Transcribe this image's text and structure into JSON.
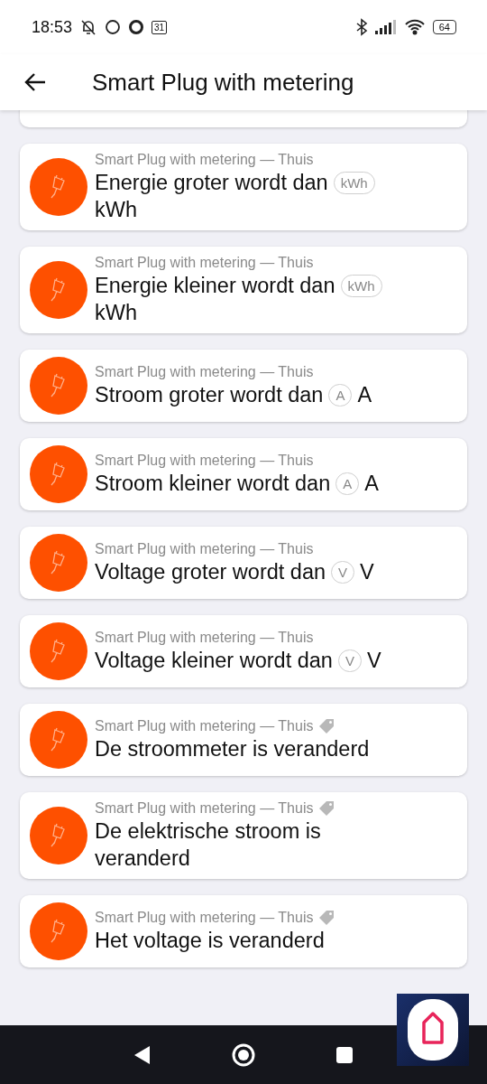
{
  "status_bar": {
    "time": "18:53",
    "calendar_day": "31",
    "battery": "64"
  },
  "app_bar": {
    "title": "Smart Plug with metering"
  },
  "cards": [
    {
      "subtitle": "Smart Plug with metering — Thuis",
      "title": "Energie groter wordt dan",
      "pill": "kWh",
      "unit": "kWh",
      "tagged": false
    },
    {
      "subtitle": "Smart Plug with metering — Thuis",
      "title": "Energie kleiner wordt dan",
      "pill": "kWh",
      "unit": "kWh",
      "tagged": false
    },
    {
      "subtitle": "Smart Plug with metering — Thuis",
      "title": "Stroom groter wordt dan",
      "pill": "A",
      "unit": "A",
      "tagged": false
    },
    {
      "subtitle": "Smart Plug with metering — Thuis",
      "title": "Stroom kleiner wordt dan",
      "pill": "A",
      "unit": "A",
      "tagged": false
    },
    {
      "subtitle": "Smart Plug with metering — Thuis",
      "title": "Voltage groter wordt dan",
      "pill": "V",
      "unit": "V",
      "tagged": false
    },
    {
      "subtitle": "Smart Plug with metering — Thuis",
      "title": "Voltage kleiner wordt dan",
      "pill": "V",
      "unit": "V",
      "tagged": false
    },
    {
      "subtitle": "Smart Plug with metering — Thuis",
      "title": "De stroommeter is veranderd",
      "tagged": true
    },
    {
      "subtitle": "Smart Plug with metering — Thuis",
      "title": "De elektrische stroom is veranderd",
      "tagged": true
    },
    {
      "subtitle": "Smart Plug with metering — Thuis",
      "title": "Het voltage is veranderd",
      "tagged": true
    }
  ]
}
